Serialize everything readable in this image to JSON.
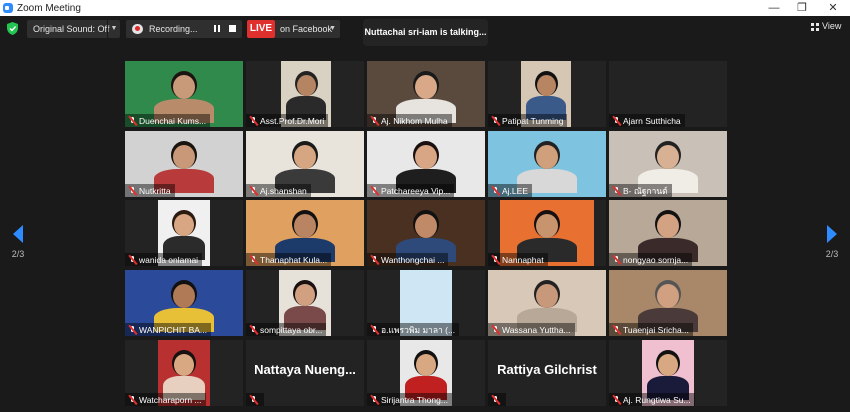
{
  "window": {
    "title": "Zoom Meeting",
    "minimize": "—",
    "maximize": "❐",
    "close": "✕"
  },
  "toolbar": {
    "audio_option": "Original Sound: Off",
    "recording_label": "Recording...",
    "live_label": "LIVE",
    "stream_target": "on Facebook",
    "view_label": "View"
  },
  "active_speaker": "Nuttachai sri-iam is talking...",
  "paging": {
    "left": "2/3",
    "right": "2/3"
  },
  "participants": [
    {
      "name": "Duenchai Kums..."
    },
    {
      "name": "Asst.Prof.Dr.Mori"
    },
    {
      "name": "Aj. Nikhom Mulha"
    },
    {
      "name": "Patipat Tunming"
    },
    {
      "name": "Ajarn Sutthicha"
    },
    {
      "name": "Nutkritta"
    },
    {
      "name": "Aj.shanshan"
    },
    {
      "name": "Patchareeya Vip..."
    },
    {
      "name": "Aj.LEE"
    },
    {
      "name": "B- ณัฐกานต์"
    },
    {
      "name": "wanida onlamai"
    },
    {
      "name": "Thanaphat Kula..."
    },
    {
      "name": "Wanthongchai ..."
    },
    {
      "name": "Nannaphat"
    },
    {
      "name": "nongyao sornja..."
    },
    {
      "name": "WANPICHIT BA..."
    },
    {
      "name": "sompittaya obr..."
    },
    {
      "name": "อ.แพรวพิม มาลา (..."
    },
    {
      "name": "Wassana Yuttha..."
    },
    {
      "name": "Tuaenjai Sricha..."
    },
    {
      "name": "Watcharaporn ..."
    },
    {
      "name": "",
      "display": "Nattaya  Nueng..."
    },
    {
      "name": "Sirijantra Thong..."
    },
    {
      "name": "",
      "display": "Rattiya Gilchrist"
    },
    {
      "name": "Aj. Rungtiwa Su..."
    }
  ],
  "colors": {
    "live": "#e0302e",
    "accent": "#2d8cff",
    "speaking": "#8cc63f"
  }
}
